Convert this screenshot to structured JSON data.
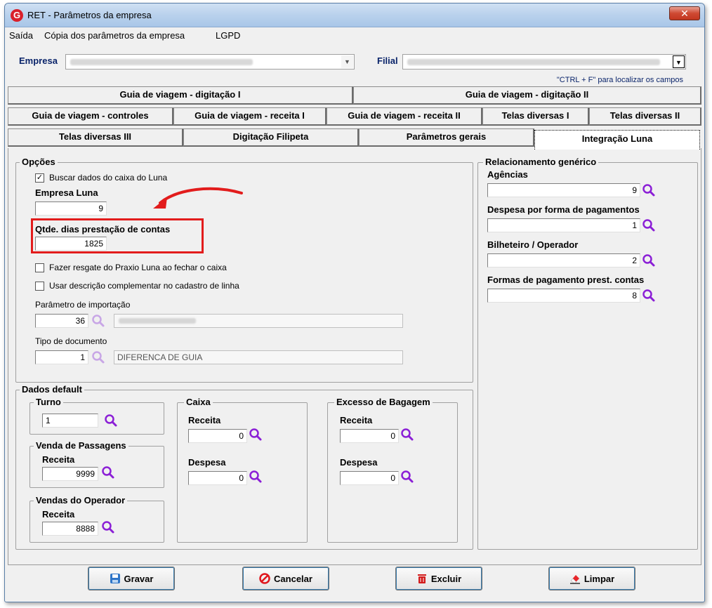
{
  "window": {
    "title": "RET - Parâmetros da empresa",
    "logo": "G",
    "close_label": "✕"
  },
  "menu": {
    "items": [
      "Saída",
      "Cópia dos parâmetros da empresa",
      "LGPD"
    ]
  },
  "header": {
    "empresa_label": "Empresa",
    "filial_label": "Filial",
    "hint": "\"CTRL + F\" para localizar os campos"
  },
  "tabs": {
    "row1": [
      "Guia de viagem - digitação I",
      "Guia de viagem - digitação II"
    ],
    "row2": [
      "Guia de viagem - controles",
      "Guia de viagem - receita I",
      "Guia de viagem - receita II",
      "Telas diversas I",
      "Telas diversas II"
    ],
    "row3": [
      "Telas diversas III",
      "Digitação Filipeta",
      "Parâmetros gerais",
      "Integração Luna"
    ],
    "active": "Integração Luna"
  },
  "opcoes": {
    "legend": "Opções",
    "buscar_label": "Buscar dados do caixa do Luna",
    "buscar_checked": true,
    "empresa_luna_label": "Empresa Luna",
    "empresa_luna_value": "9",
    "qtde_label": "Qtde. dias prestação de contas",
    "qtde_value": "1825",
    "resgate_label": "Fazer resgate do Praxio Luna ao fechar o caixa",
    "resgate_checked": false,
    "descricao_label": "Usar descrição complementar no cadastro de linha",
    "descricao_checked": false,
    "param_import_label": "Parâmetro de importação",
    "param_import_value": "36",
    "tipo_doc_label": "Tipo de documento",
    "tipo_doc_value": "1",
    "tipo_doc_desc": "DIFERENCA DE GUIA"
  },
  "relacionamento": {
    "legend": "Relacionamento genérico",
    "agencias_label": "Agências",
    "agencias_value": "9",
    "despesa_forma_label": "Despesa por forma de pagamentos",
    "despesa_forma_value": "1",
    "bilheteiro_label": "Bilheteiro / Operador",
    "bilheteiro_value": "2",
    "formas_label": "Formas de pagamento prest. contas",
    "formas_value": "8"
  },
  "dados_default": {
    "legend": "Dados default",
    "turno": {
      "legend": "Turno",
      "value": "1"
    },
    "venda_passagens": {
      "legend": "Venda de Passagens",
      "receita_label": "Receita",
      "receita_value": "9999"
    },
    "vendas_operador": {
      "legend": "Vendas do Operador",
      "receita_label": "Receita",
      "receita_value": "8888"
    },
    "caixa": {
      "legend": "Caixa",
      "receita_label": "Receita",
      "receita_value": "0",
      "despesa_label": "Despesa",
      "despesa_value": "0"
    },
    "excesso": {
      "legend": "Excesso de Bagagem",
      "receita_label": "Receita",
      "receita_value": "0",
      "despesa_label": "Despesa",
      "despesa_value": "0"
    }
  },
  "buttons": {
    "gravar": "Gravar",
    "cancelar": "Cancelar",
    "excluir": "Excluir",
    "limpar": "Limpar"
  },
  "colors": {
    "accent_search": "#8b1fd6",
    "highlight": "#e21c1c",
    "label_blue": "#0a246a"
  }
}
